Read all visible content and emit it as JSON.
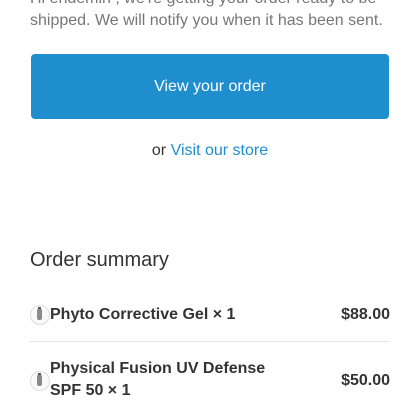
{
  "intro": {
    "text": "Hi endemin , we're getting your order ready to be shipped. We will notify you when it has been sent."
  },
  "actions": {
    "view_order_label": "View your order",
    "or_text": "or",
    "visit_store_label": "Visit our store"
  },
  "colors": {
    "accent": "#1f8ece",
    "text": "#333333",
    "muted": "#777777"
  },
  "summary": {
    "title": "Order summary",
    "items": [
      {
        "name": "Phyto Corrective Gel × 1",
        "price": "$88.00",
        "icon": "product-thumbnail-icon"
      },
      {
        "name": "Physical Fusion UV Defense SPF 50 × 1",
        "price": "$50.00",
        "icon": "product-thumbnail-icon"
      }
    ]
  }
}
